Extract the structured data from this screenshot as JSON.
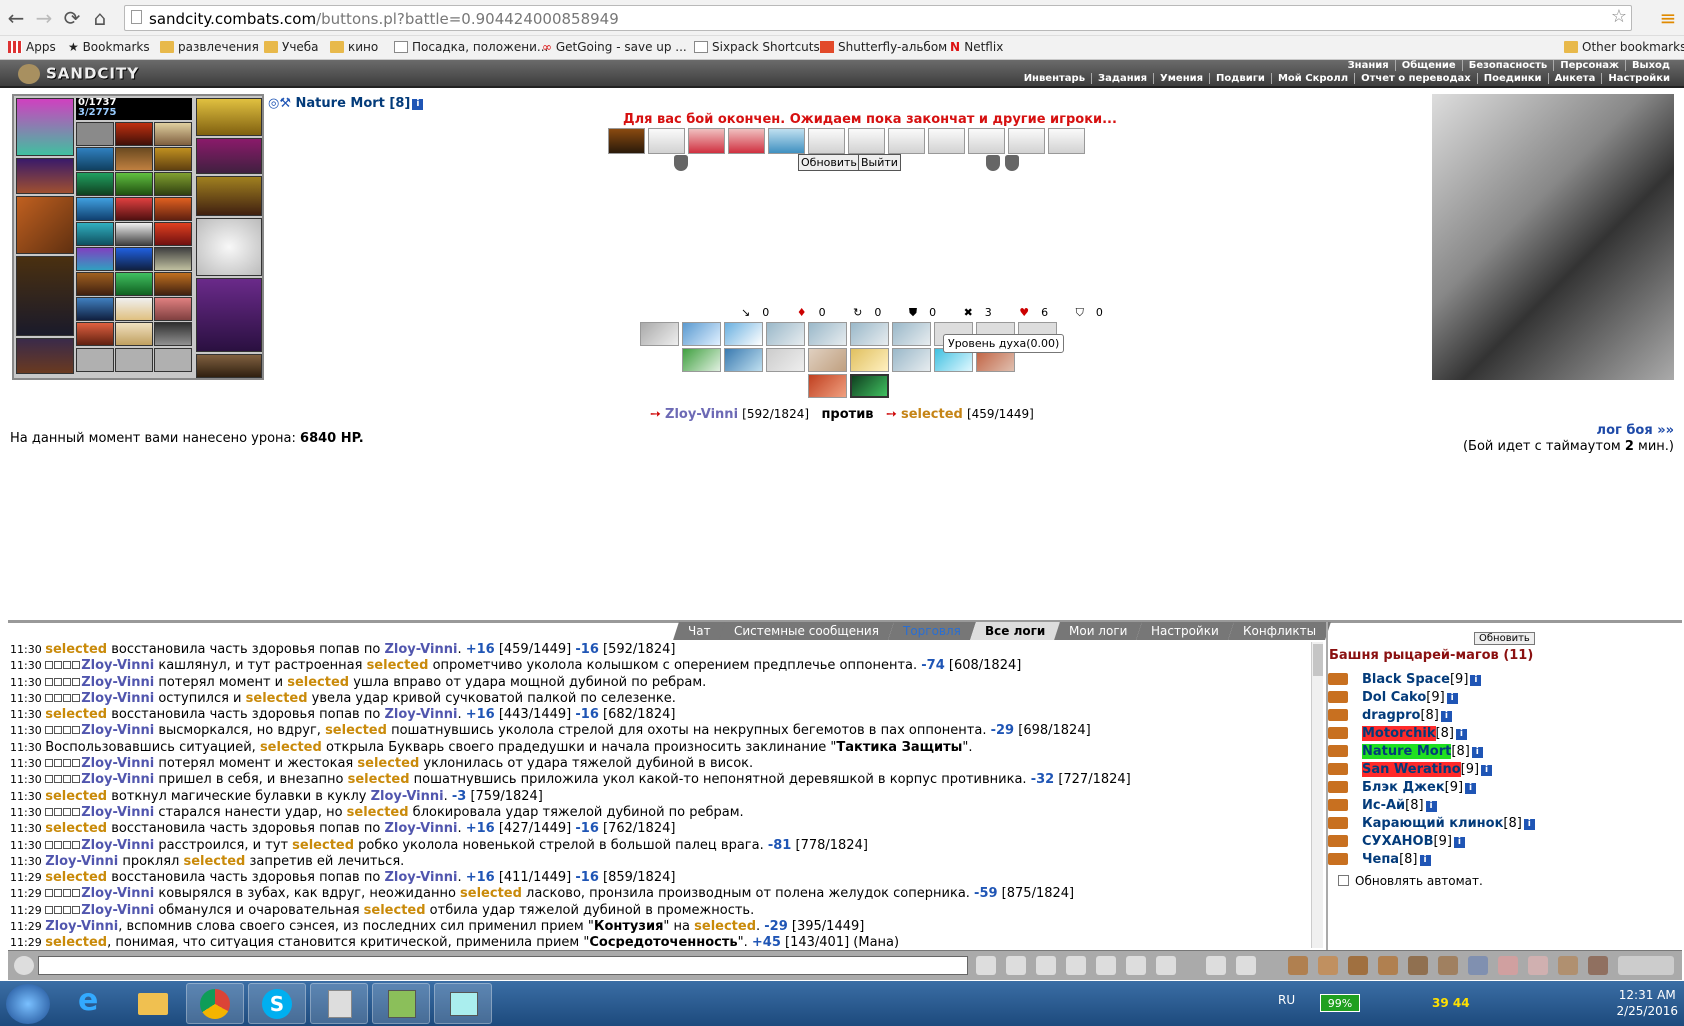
{
  "browser": {
    "url_domain": "sandcity.combats.com",
    "url_path": "/buttons.pl?battle=0.904424000858949",
    "bookmarks": [
      "Apps",
      "Bookmarks",
      "развлечения",
      "Учеба",
      "кино",
      "Посадка, положени...",
      "GetGoing - save up ...",
      "Sixpack Shortcuts",
      "Shutterfly-альбом",
      "Netflix",
      "Other bookmarks"
    ]
  },
  "game": {
    "logo": "SANDCITY",
    "menu_top": [
      "Знания",
      "Общение",
      "Безопасность",
      "Персонаж",
      "Выход"
    ],
    "menu_bottom": [
      "Инвентарь",
      "Задания",
      "Умения",
      "Подвиги",
      "Мой Скролл",
      "Отчет о переводах",
      "Поединки",
      "Анкета",
      "Настройки"
    ],
    "stats_line1": "0/1737",
    "stats_line2": "3/2775",
    "player_name": "Nature Mort [8]",
    "battle_message": "Для вас бой окончен. Ожидаем пока закончат и другие игроки...",
    "refresh_button": "Обновить",
    "exit_button": "Выйти",
    "counters": [
      "0",
      "0",
      "0",
      "0",
      "3",
      "6",
      "0"
    ],
    "tooltip": "Уровень духа(0.00)",
    "fighter1": "Zloy-Vinni",
    "fighter1_hp": "[592/1824]",
    "versus": "против",
    "fighter2": "selected",
    "fighter2_hp": "[459/1449]",
    "damage_label": "На данный момент вами нанесено урона:",
    "damage_value": "6840 HP.",
    "log_link": "лог боя »»",
    "timeout_pre": "(Бой идет с таймаутом",
    "timeout_num": "2",
    "timeout_post": "мин.)"
  },
  "chat": {
    "tabs": [
      "Чат",
      "Системные сообщения",
      "Торговля",
      "Все логи",
      "Мои логи",
      "Настройки",
      "Конфликты"
    ],
    "log": [
      {
        "time": "11:30",
        "html": "<span class=\"sel\">selected</span> восстановила часть здоровья попав по <span class=\"zv\">Zloy-Vinni</span>. <b class=\"pos\">+16</b> [459/1449] <b class=\"neg\">-16</b> [592/1824]"
      },
      {
        "time": "11:30",
        "html": "<span class=\"sq\"></span><span class=\"sq\"></span><span class=\"sq\"></span><span class=\"sq\"></span><span class=\"zv\">Zloy-Vinni</span> кашлянул, и тут растроенная <span class=\"sel\">selected</span> опрометчиво уколола колышком с оперением предплечье оппонента. <b class=\"neg\">-74</b> [608/1824]"
      },
      {
        "time": "11:30",
        "html": "<span class=\"sq\"></span><span class=\"sq\"></span><span class=\"sq\"></span><span class=\"sq\"></span><span class=\"zv\">Zloy-Vinni</span> потерял момент и <span class=\"sel\">selected</span> ушла вправо от удара мощной дубиной по ребрам."
      },
      {
        "time": "11:30",
        "html": "<span class=\"sq\"></span><span class=\"sq\"></span><span class=\"sq\"></span><span class=\"sq\"></span><span class=\"zv\">Zloy-Vinni</span> оступился и <span class=\"sel\">selected</span> увела удар кривой сучковатой палкой по селезенке."
      },
      {
        "time": "11:30",
        "html": "<span class=\"sel\">selected</span> восстановила часть здоровья попав по <span class=\"zv\">Zloy-Vinni</span>. <b class=\"pos\">+16</b> [443/1449] <b class=\"neg\">-16</b> [682/1824]"
      },
      {
        "time": "11:30",
        "html": "<span class=\"sq\"></span><span class=\"sq\"></span><span class=\"sq\"></span><span class=\"sq\"></span><span class=\"zv\">Zloy-Vinni</span> высморкался, но вдруг, <span class=\"sel\">selected</span> пошатнувшись уколола стрелой для охоты на некрупных бегемотов в пах оппонента. <b class=\"neg\">-29</b> [698/1824]"
      },
      {
        "time": "11:30",
        "html": "Воспользовавшись ситуацией, <span class=\"sel\">selected</span> открыла Букварь своего прадедушки и начала произносить заклинание \"<b>Тактика Защиты</b>\"."
      },
      {
        "time": "11:30",
        "html": "<span class=\"sq\"></span><span class=\"sq\"></span><span class=\"sq\"></span><span class=\"sq\"></span><span class=\"zv\">Zloy-Vinni</span> потерял момент и жестокая <span class=\"sel\">selected</span> уклонилась от удара тяжелой дубиной в висок."
      },
      {
        "time": "11:30",
        "html": "<span class=\"sq\"></span><span class=\"sq\"></span><span class=\"sq\"></span><span class=\"sq\"></span><span class=\"zv\">Zloy-Vinni</span> пришел в себя, и внезапно <span class=\"sel\">selected</span> пошатнувшись приложила укол какой-то непонятной деревяшкой в корпус противника. <b class=\"neg\">-32</b> [727/1824]"
      },
      {
        "time": "11:30",
        "html": "<span class=\"sel\">selected</span> воткнул магические булавки в куклу <span class=\"zv\">Zloy-Vinni</span>. <b class=\"neg\">-3</b> [759/1824]"
      },
      {
        "time": "11:30",
        "html": "<span class=\"sq\"></span><span class=\"sq\"></span><span class=\"sq\"></span><span class=\"sq\"></span><span class=\"zv\">Zloy-Vinni</span> старался нанести удар, но <span class=\"sel\">selected</span> блокировала удар тяжелой дубиной по ребрам."
      },
      {
        "time": "11:30",
        "html": "<span class=\"sel\">selected</span> восстановила часть здоровья попав по <span class=\"zv\">Zloy-Vinni</span>. <b class=\"pos\">+16</b> [427/1449] <b class=\"neg\">-16</b> [762/1824]"
      },
      {
        "time": "11:30",
        "html": "<span class=\"sq\"></span><span class=\"sq\"></span><span class=\"sq\"></span><span class=\"sq\"></span><span class=\"zv\">Zloy-Vinni</span> расстроился, и тут <span class=\"sel\">selected</span> робко уколола новенькой стрелой в большой палец врага. <b class=\"neg\">-81</b> [778/1824]"
      },
      {
        "time": "11:30",
        "html": "<span class=\"zv\">Zloy-Vinni</span> проклял <span class=\"sel\">selected</span> запретив ей лечиться."
      },
      {
        "time": "11:29",
        "html": "<span class=\"sel\">selected</span> восстановила часть здоровья попав по <span class=\"zv\">Zloy-Vinni</span>. <b class=\"pos\">+16</b> [411/1449] <b class=\"neg\">-16</b> [859/1824]"
      },
      {
        "time": "11:29",
        "html": "<span class=\"sq\"></span><span class=\"sq\"></span><span class=\"sq\"></span><span class=\"sq\"></span><span class=\"zv\">Zloy-Vinni</span> ковырялся в зубах, как вдруг, неожиданно <span class=\"sel\">selected</span> ласково, пронзила производным от полена желудок соперника. <b class=\"neg\">-59</b> [875/1824]"
      },
      {
        "time": "11:29",
        "html": "<span class=\"sq\"></span><span class=\"sq\"></span><span class=\"sq\"></span><span class=\"sq\"></span><span class=\"zv\">Zloy-Vinni</span> обманулся и очаровательная <span class=\"sel\">selected</span> отбила удар тяжелой дубиной в промежность."
      },
      {
        "time": "11:29",
        "html": "<span class=\"zv\">Zloy-Vinni</span>, вспомнив слова своего сэнсея, из последних сил применил прием \"<b>Контузия</b>\" на <span class=\"sel\">selected</span>. <b class=\"neg\">-29</b> [395/1449]"
      },
      {
        "time": "11:29",
        "html": "<span class=\"sel\">selected</span>, понимая, что ситуация становится критической, применила прием \"<b>Сосредоточенность</b>\". <b class=\"pos\">+45</b> [143/401] (Мана)"
      }
    ]
  },
  "clan": {
    "refresh": "Обновить",
    "title": "Башня рыцарей-магов (11)",
    "members": [
      {
        "name": "Black Space",
        "lvl": "[9]"
      },
      {
        "name": "Dol Cako",
        "lvl": "[9]"
      },
      {
        "name": "dragpro",
        "lvl": "[8]"
      },
      {
        "name": "Motorchik",
        "lvl": "[8]"
      },
      {
        "name": "Nature Mort",
        "lvl": "[8]"
      },
      {
        "name": "San Weratino",
        "lvl": "[9]"
      },
      {
        "name": "Блэк Джек",
        "lvl": "[9]"
      },
      {
        "name": "Ис-Ай",
        "lvl": "[8]"
      },
      {
        "name": "Карающий клинок",
        "lvl": "[8]"
      },
      {
        "name": "СУХАНОВ",
        "lvl": "[9]"
      },
      {
        "name": "Чепа",
        "lvl": "[8]"
      }
    ],
    "auto_update": "Обновлять автомат."
  },
  "taskbar": {
    "lang": "RU",
    "battery": "99%",
    "nums": "39  44",
    "time": "12:31 AM",
    "date": "2/25/2016"
  }
}
